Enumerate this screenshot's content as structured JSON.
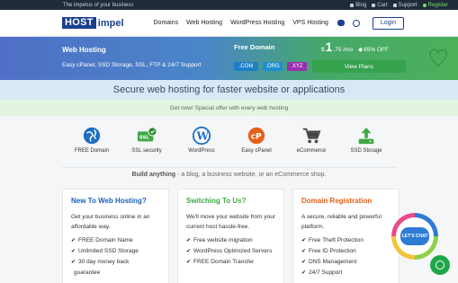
{
  "topbar": {
    "tagline": "The impetus of your business",
    "links": [
      {
        "icon": "blog-icon",
        "label": "Blog"
      },
      {
        "icon": "cart-icon",
        "label": "Cart"
      },
      {
        "icon": "support-icon",
        "label": "Support"
      },
      {
        "icon": "register-icon",
        "label": "Register"
      }
    ]
  },
  "logo": {
    "box": "HOST",
    "rest": "impel"
  },
  "nav": {
    "items": [
      "Domains",
      "Web Hosting",
      "WordPress Hosting",
      "VPS Hosting"
    ],
    "login": "Login"
  },
  "banner": {
    "title": "Web Hosting",
    "features": "Easy cPanel, SSD Storage, SSL, FTP & 24/7 Support",
    "free_domain": "Free Domain",
    "price_currency": "$",
    "price_whole": "1",
    "price_rest": ".75 /mo",
    "discount": "65% OFF",
    "tlds": [
      ".COM",
      ".ORG",
      ".XYZ"
    ],
    "cta": "View Plans"
  },
  "tagline": "Secure web hosting for faster website or applications",
  "offer": "Get now! Special offer with every web hosting",
  "features": [
    {
      "icon": "globe-icon",
      "label": "FREE Domain"
    },
    {
      "icon": "ssl-icon",
      "label": "SSL security"
    },
    {
      "icon": "wordpress-icon",
      "label": "WordPress"
    },
    {
      "icon": "cpanel-icon",
      "label": "Easy cPanel"
    },
    {
      "icon": "cart-icon",
      "label": "eCommerce"
    },
    {
      "icon": "upload-icon",
      "label": "SSD Storage"
    }
  ],
  "build": {
    "bold": "Build anything",
    "rest": " - a blog, a business website, or an eCommerce shop."
  },
  "cards": [
    {
      "title": "New To Web Hosting?",
      "color": "#1b5fb7",
      "desc": "Get your business online in an affordable way.",
      "items": [
        "FREE Domain Name",
        "Unlimited SSD Storage",
        "30 day money back",
        "guarantee"
      ]
    },
    {
      "title": "Switching To Us?",
      "color": "#3fa845",
      "desc": "We'll move your website from your current host hassle-free.",
      "items": [
        "Free website migration",
        "WordPress Optimized Servers",
        "FREE Domain Transfer"
      ]
    },
    {
      "title": "Domain Registration",
      "color": "#e5601a",
      "desc": "A secure, reliable and powerful platform.",
      "items": [
        "Free Theft Protection",
        "Free ID Protection",
        "DNS Management",
        "24/7 Support"
      ]
    }
  ],
  "chat_widget": "LET'S CHAT"
}
